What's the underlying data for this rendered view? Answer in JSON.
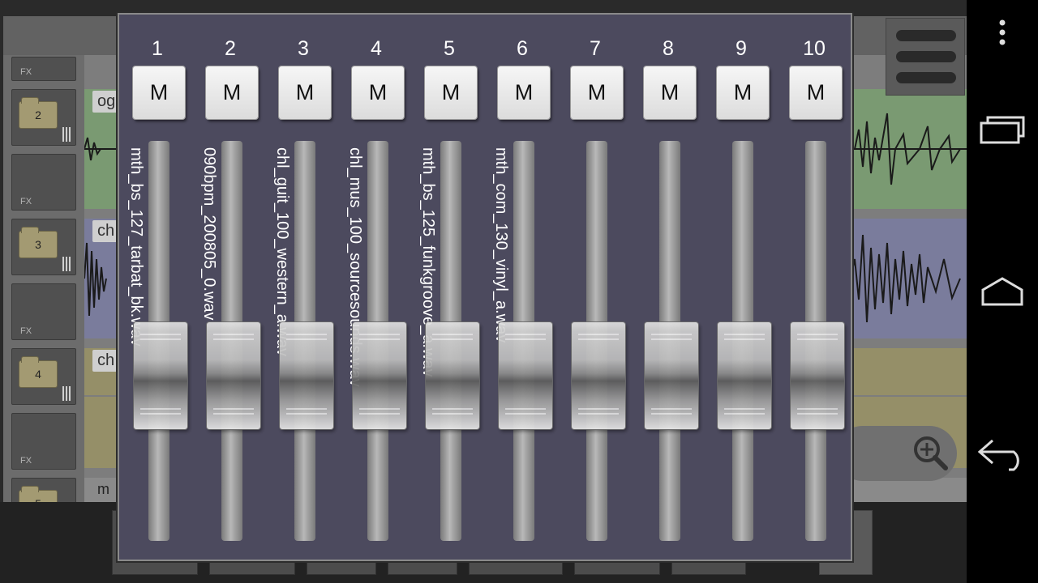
{
  "background": {
    "fx_label": "FX",
    "tracks": [
      {
        "number": "2",
        "clip_label": "og"
      },
      {
        "number": "3",
        "clip_label": "ch"
      },
      {
        "number": "4",
        "clip_label": "ch"
      },
      {
        "number": "5",
        "clip_label": "m"
      }
    ],
    "lane_colors": [
      "#7a9a72",
      "#7a7c9c",
      "#958f68",
      "#958f68",
      "#7d7d7d"
    ]
  },
  "mixer": {
    "mute_label": "M",
    "channels": [
      {
        "number": "1",
        "file": "mth_bs_127_tarbat_bk.wav",
        "volume_pct": 62
      },
      {
        "number": "2",
        "file": "090bpm_200805_0.wav",
        "volume_pct": 62
      },
      {
        "number": "3",
        "file": "chl_guit_100_western_a.wav",
        "volume_pct": 62
      },
      {
        "number": "4",
        "file": "chl_mus_100_sourcesounds.wav",
        "volume_pct": 62
      },
      {
        "number": "5",
        "file": "mth_bs_125_funkgroove_a.wav",
        "volume_pct": 62
      },
      {
        "number": "6",
        "file": "mth_com_130_vinyl_a.wav",
        "volume_pct": 62
      },
      {
        "number": "7",
        "file": "",
        "volume_pct": 62
      },
      {
        "number": "8",
        "file": "",
        "volume_pct": 62
      },
      {
        "number": "9",
        "file": "",
        "volume_pct": 62
      },
      {
        "number": "10",
        "file": "",
        "volume_pct": 62
      }
    ]
  },
  "icons": {
    "overflow": "overflow-menu-icon",
    "recent": "recent-apps-icon",
    "home": "home-icon",
    "back": "back-icon",
    "zoom": "zoom-in-icon",
    "menu": "hamburger-menu-icon"
  }
}
